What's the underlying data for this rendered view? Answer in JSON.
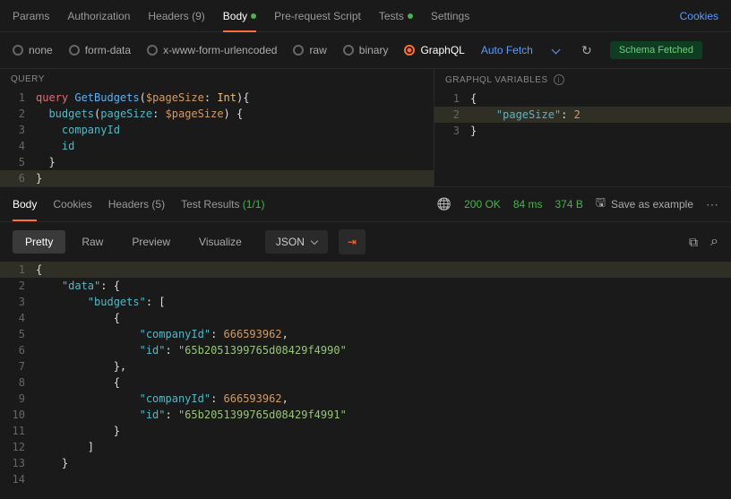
{
  "requestTabs": {
    "params": "Params",
    "authorization": "Authorization",
    "headers": "Headers",
    "headersCount": "(9)",
    "body": "Body",
    "prerequest": "Pre-request Script",
    "tests": "Tests",
    "settings": "Settings"
  },
  "cookies": "Cookies",
  "bodyTypes": {
    "none": "none",
    "formData": "form-data",
    "urlencoded": "x-www-form-urlencoded",
    "raw": "raw",
    "binary": "binary",
    "graphql": "GraphQL"
  },
  "autofetch": "Auto Fetch",
  "schemaFetched": "Schema Fetched",
  "queryHeader": "QUERY",
  "variablesHeader": "GRAPHQL VARIABLES",
  "queryLines": {
    "l1a": "query",
    "l1b": "GetBudgets",
    "l1c": "$pageSize",
    "l1d": "Int",
    "l2a": "budgets",
    "l2b": "pageSize",
    "l2c": "$pageSize",
    "l3": "companyId",
    "l4": "id"
  },
  "varsLines": {
    "k": "\"pageSize\"",
    "v": "2"
  },
  "responseTabs": {
    "body": "Body",
    "cookies": "Cookies",
    "headers": "Headers",
    "headersCount": "(5)",
    "testResults": "Test Results",
    "testCount": "(1/1)"
  },
  "status": {
    "code": "200 OK",
    "time": "84 ms",
    "size": "374 B"
  },
  "saveExample": "Save as example",
  "viewModes": {
    "pretty": "Pretty",
    "raw": "Raw",
    "preview": "Preview",
    "visualize": "Visualize"
  },
  "jsonLabel": "JSON",
  "resp": {
    "data": "\"data\"",
    "budgets": "\"budgets\"",
    "companyId": "\"companyId\"",
    "companyIdVal": "666593962",
    "id": "\"id\"",
    "idVal1": "\"65b2051399765d08429f4990\"",
    "idVal2": "\"65b2051399765d08429f4991\""
  },
  "chart_data": null
}
